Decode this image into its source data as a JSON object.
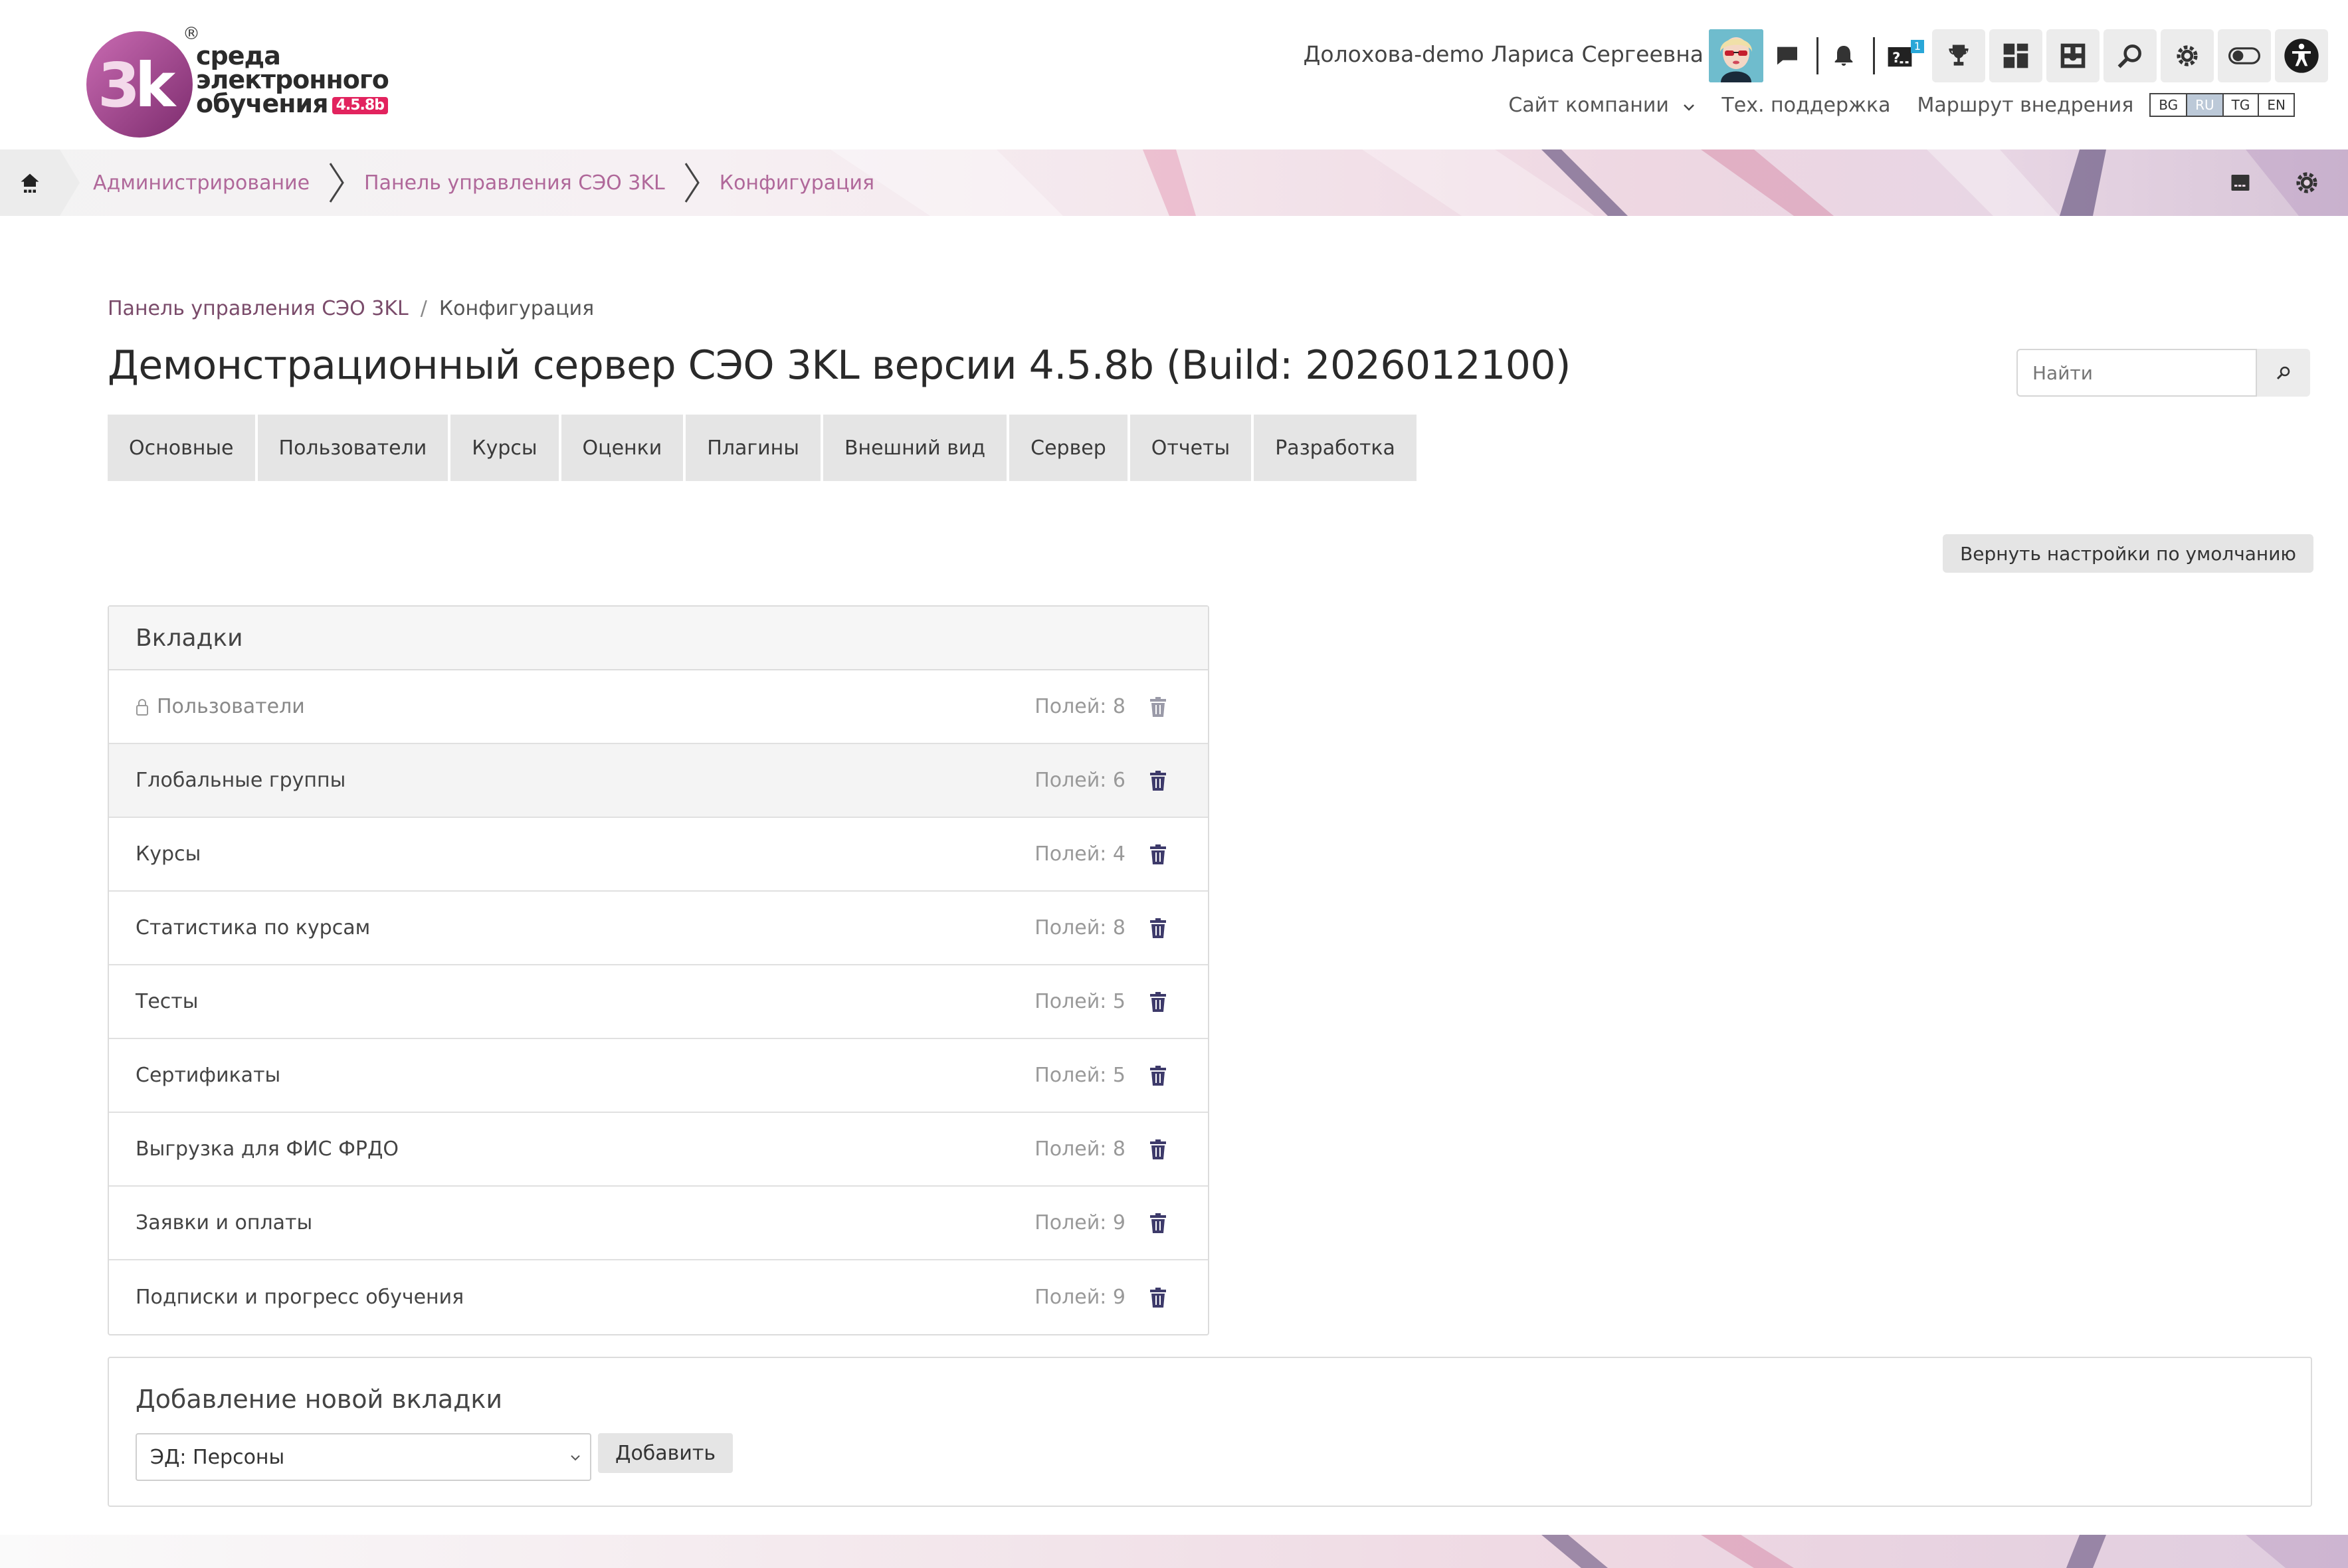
{
  "brand": {
    "line1": "среда",
    "line2": "электронного",
    "line3": "обучения",
    "version_badge": "4.5.8b",
    "registered": "®",
    "colors": {
      "accent": "#e2235e",
      "logo_purple": "#9c3a8a",
      "link": "#b0689a"
    }
  },
  "header": {
    "user_name": "Долохова-demo Лариса Сергеевна",
    "icons": [
      "chat-icon",
      "bell-icon",
      "help-queue-icon",
      "trophy-icon",
      "dashboard-icon",
      "catalog-icon",
      "search-icon",
      "gear-icon",
      "theme-toggle-icon",
      "accessibility-icon"
    ],
    "help_badge": "1",
    "links": {
      "company_site": "Сайт компании",
      "support": "Тех. поддержка",
      "route": "Маршрут внедрения"
    },
    "languages": [
      "BG",
      "RU",
      "TG",
      "EN"
    ],
    "active_language": "RU"
  },
  "navbar": {
    "crumbs": [
      "Администрирование",
      "Панель управления СЭО 3KL",
      "Конфигурация"
    ]
  },
  "page": {
    "subcrumb_link": "Панель управления СЭО 3KL",
    "subcrumb_sep": "/",
    "subcrumb_current": "Конфигурация",
    "title": "Демонстрационный сервер СЭО 3KL версии 4.5.8b (Build: 2026012100)",
    "search_placeholder": "Найти",
    "tabs": [
      "Основные",
      "Пользователи",
      "Курсы",
      "Оценки",
      "Плагины",
      "Внешний вид",
      "Сервер",
      "Отчеты",
      "Разработка"
    ],
    "reset_label": "Вернуть настройки по умолчанию"
  },
  "tabs_panel": {
    "title": "Вкладки",
    "rows": [
      {
        "name": "Пользователи",
        "fields": "Полей: 8",
        "locked": true
      },
      {
        "name": "Глобальные группы",
        "fields": "Полей: 6"
      },
      {
        "name": "Курсы",
        "fields": "Полей: 4"
      },
      {
        "name": "Статистика по курсам",
        "fields": "Полей: 8"
      },
      {
        "name": "Тесты",
        "fields": "Полей: 5"
      },
      {
        "name": "Сертификаты",
        "fields": "Полей: 5"
      },
      {
        "name": "Выгрузка для ФИС ФРДО",
        "fields": "Полей: 8"
      },
      {
        "name": "Заявки и оплаты",
        "fields": "Полей: 9"
      },
      {
        "name": "Подписки и прогресс обучения",
        "fields": "Полей: 9"
      }
    ]
  },
  "add_panel": {
    "title": "Добавление новой вкладки",
    "selected": "ЭД: Персоны",
    "button": "Добавить"
  }
}
